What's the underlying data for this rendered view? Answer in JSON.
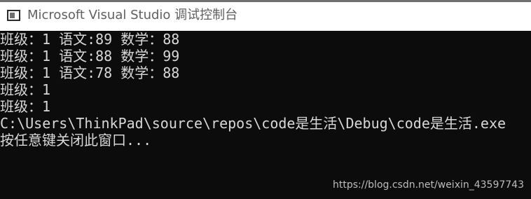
{
  "window": {
    "title": "Microsoft Visual Studio 调试控制台",
    "icon": "console-window-icon",
    "title_color": "#5f5f5f",
    "background": "#0c0c0c",
    "text_color": "#d8d8d8"
  },
  "console": {
    "lines": [
      "班级：1 语文:89 数学：88",
      "班级：1 语文:88 数学：99",
      "班级：1 语文:78 数学：88",
      "班级：1",
      "班级：1",
      "C:\\Users\\ThinkPad\\source\\repos\\code是生活\\Debug\\code是生活.exe",
      "按任意键关闭此窗口..."
    ]
  },
  "watermark": {
    "text": "https://blog.csdn.net/weixin_43597743"
  }
}
